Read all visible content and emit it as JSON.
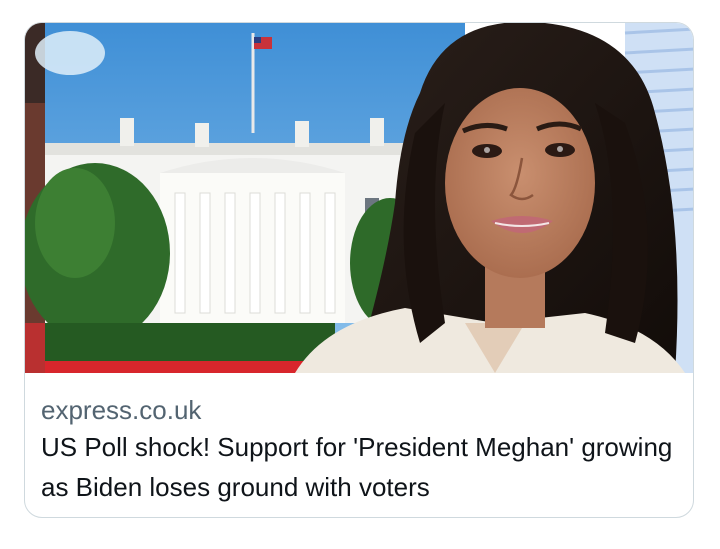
{
  "link_card": {
    "domain": "express.co.uk",
    "headline": "US Poll shock! Support for 'President Meghan' growing as Biden loses ground with voters",
    "image_alt": "White House and a smiling woman with long dark hair"
  },
  "colors": {
    "border": "#cfd9de",
    "domain_text": "#536471",
    "headline_text": "#0f1419"
  }
}
